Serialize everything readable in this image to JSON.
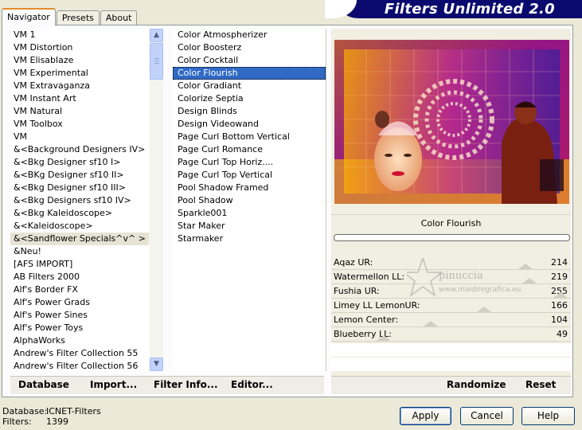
{
  "tabs": [
    {
      "label": "Navigator",
      "active": true
    },
    {
      "label": "Presets",
      "active": false
    },
    {
      "label": "About",
      "active": false
    }
  ],
  "banner_title": "Filters Unlimited 2.0",
  "categories": [
    "VM 1",
    "VM Distortion",
    "VM Elisablaze",
    "VM Experimental",
    "VM Extravaganza",
    "VM Instant Art",
    "VM Natural",
    "VM Toolbox",
    "VM",
    "&<Background Designers IV>",
    "&<Bkg Designer sf10 I>",
    "&<BKg Designer sf10 II>",
    "&<Bkg Designer sf10 III>",
    "&<Bkg Designers sf10 IV>",
    "&<Bkg Kaleidoscope>",
    "&<Kaleidoscope>",
    "&<Sandflower Specials^v^ >",
    "&Neu!",
    "[AFS IMPORT]",
    "AB Filters 2000",
    "Alf's Border FX",
    "Alf's Power Grads",
    "Alf's Power Sines",
    "Alf's Power Toys",
    "AlphaWorks",
    "Andrew's Filter Collection 55",
    "Andrew's Filter Collection 56"
  ],
  "selected_category": "&<Sandflower Specials^v^ >",
  "filters": [
    "Color Atmospherizer",
    "Color Boosterz",
    "Color Cocktail",
    "Color Flourish",
    "Color Gradiant",
    "Colorize Septia",
    "Design Blinds",
    "Design Videowand",
    "Page Curl Bottom Vertical",
    "Page Curl Romance",
    "Page Curl Top Horiz....",
    "Page Curl Top Vertical",
    "Pool Shadow Framed",
    "Pool Shadow",
    "Sparkle001",
    "Star Maker",
    "Starmaker"
  ],
  "selected_filter": "Color Flourish",
  "nav_buttons": {
    "database": "Database",
    "import": "Import...",
    "filter_info": "Filter Info...",
    "editor": "Editor..."
  },
  "filter_name": "Color Flourish",
  "sliders": [
    {
      "label": "Aqaz UR:",
      "value": 214
    },
    {
      "label": "Watermellon LL:",
      "value": 219
    },
    {
      "label": "Fushia UR:",
      "value": 255
    },
    {
      "label": "Limey LL LemonUR:",
      "value": 166
    },
    {
      "label": "Lemon Center:",
      "value": 104
    },
    {
      "label": "Blueberry LL:",
      "value": 49
    }
  ],
  "right_buttons": {
    "randomize": "Randomize",
    "reset": "Reset"
  },
  "status": {
    "database_label": "Database:",
    "database_value": "ICNET-Filters",
    "filters_label": "Filters:",
    "filters_value": "1399"
  },
  "dialog_buttons": {
    "apply": "Apply",
    "cancel": "Cancel",
    "help": "Help"
  },
  "watermark": {
    "name": "pinuccia",
    "site": "www.maidiregrafica.eu"
  }
}
